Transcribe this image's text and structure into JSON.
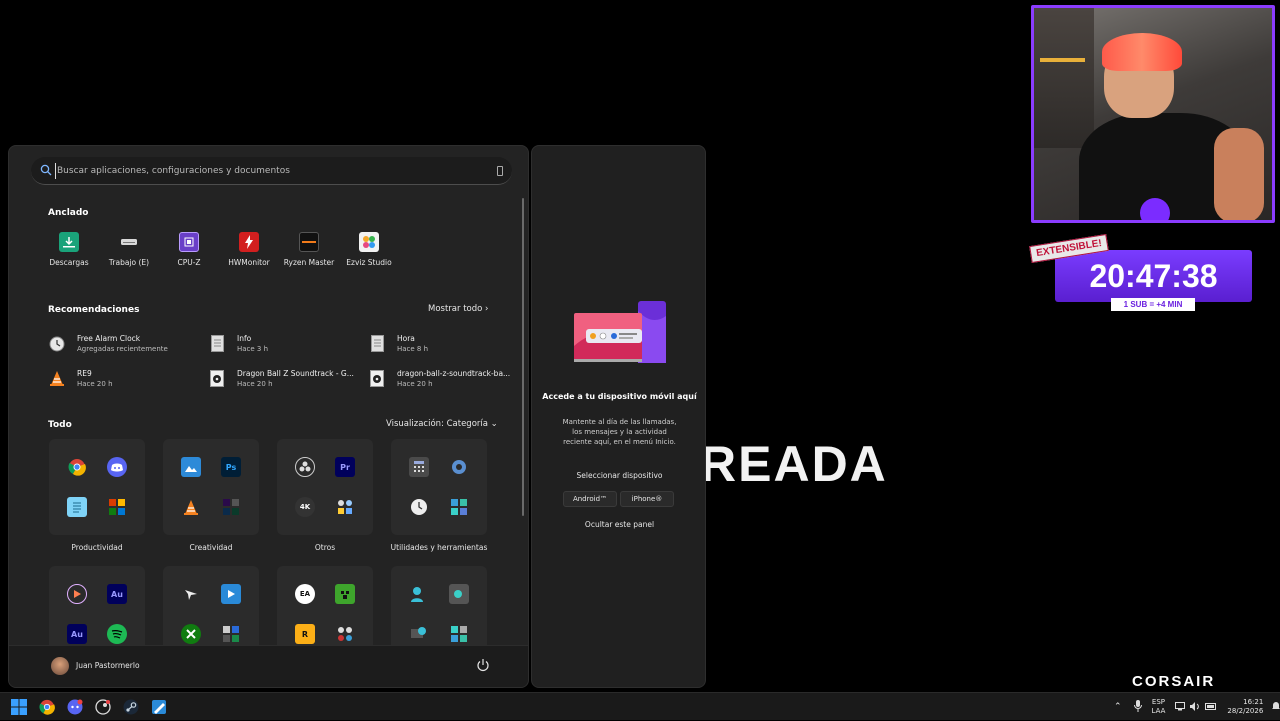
{
  "search": {
    "placeholder": "Buscar aplicaciones, configuraciones y documentos"
  },
  "pinned": {
    "title": "Anclado",
    "items": [
      {
        "label": "Descargas",
        "icon": "downloads-folder-icon",
        "color": "#1aa37a"
      },
      {
        "label": "Trabajo (E)",
        "icon": "drive-icon",
        "color": "#cfcfcf"
      },
      {
        "label": "CPU-Z",
        "icon": "cpuz-icon",
        "color": "#6a3fc8"
      },
      {
        "label": "HWMonitor",
        "icon": "hwmonitor-icon",
        "color": "#d21f1f"
      },
      {
        "label": "Ryzen Master",
        "icon": "ryzen-master-icon",
        "color": "#1a1a1a"
      },
      {
        "label": "Ezviz Studio",
        "icon": "ezviz-studio-icon",
        "color": "#e9e9e9"
      }
    ]
  },
  "recommendations": {
    "title": "Recomendaciones",
    "more_label": "Mostrar todo",
    "items": [
      {
        "name": "Free Alarm Clock",
        "sub": "Agregadas recientemente",
        "icon": "alarm-clock-icon"
      },
      {
        "name": "Info",
        "sub": "Hace 3 h",
        "icon": "document-icon"
      },
      {
        "name": "Hora",
        "sub": "Hace 8 h",
        "icon": "document-icon"
      },
      {
        "name": "RE9",
        "sub": "Hace 20 h",
        "icon": "vlc-icon"
      },
      {
        "name": "Dragon Ball Z Soundtrack - G...",
        "sub": "Hace 20 h",
        "icon": "audio-file-icon"
      },
      {
        "name": "dragon-ball-z-soundtrack-ba...",
        "sub": "Hace 20 h",
        "icon": "audio-file-icon"
      }
    ]
  },
  "all": {
    "title": "Todo",
    "view_label": "Visualización: Categoría",
    "folders": [
      {
        "label": "Productividad",
        "icons": [
          "chrome-icon",
          "discord-icon",
          "notepad-icon",
          "office-apps-icon"
        ]
      },
      {
        "label": "Creatividad",
        "icons": [
          "photos-icon",
          "photoshop-icon",
          "vlc-icon",
          "adobe-apps-icon"
        ]
      },
      {
        "label": "Otros",
        "icons": [
          "obs-icon",
          "premiere-icon",
          "4k-video-icon",
          "misc-apps-icon"
        ]
      },
      {
        "label": "Utilidades y herramientas",
        "icons": [
          "calculator-icon",
          "settings-icon",
          "clock-icon",
          "network-tools-icon"
        ]
      },
      {
        "label": "",
        "icons": [
          "media-player-icon",
          "audition-icon",
          "audition-icon",
          "spotify-icon"
        ]
      },
      {
        "label": "",
        "icons": [
          "game-bird-icon",
          "movie-maker-icon",
          "xbox-icon",
          "game-apps-icon"
        ]
      },
      {
        "label": "",
        "icons": [
          "ea-icon",
          "minecraft-icon",
          "rockstar-icon",
          "gaming-tools-icon"
        ]
      },
      {
        "label": "",
        "icons": [
          "people-icon",
          "remote-desktop-icon",
          "quick-assist-icon",
          "system-tools-icon"
        ]
      }
    ]
  },
  "user": {
    "name": "Juan Pastormerlo"
  },
  "phone_panel": {
    "title": "Accede a tu dispositivo móvil aquí",
    "description": "Mantente al día de las llamadas, los mensajes y la actividad reciente aquí, en el menú Inicio.",
    "select_label": "Seleccionar dispositivo",
    "android_label": "Android™",
    "iphone_label": "iPhone®",
    "hide_label": "Ocultar este panel"
  },
  "overlay": {
    "background_text": "READA",
    "extensible_label": "EXTENSIBLE!",
    "timer": "20:47:38",
    "sub_rule": "1 SUB = +4 MIN",
    "sponsor": "CORSAIR"
  },
  "taskbar": {
    "apps": [
      "windows-start-icon",
      "chrome-icon",
      "discord-icon",
      "steam-alt-icon",
      "steam-icon",
      "photos-pen-icon"
    ],
    "lang_top": "ESP",
    "lang_bottom": "LAA",
    "time": "16:21",
    "date": "28/2/2026"
  },
  "colors": {
    "accent": "#8b3cff",
    "menu_bg": "#232323",
    "panel_bg": "#202020"
  }
}
